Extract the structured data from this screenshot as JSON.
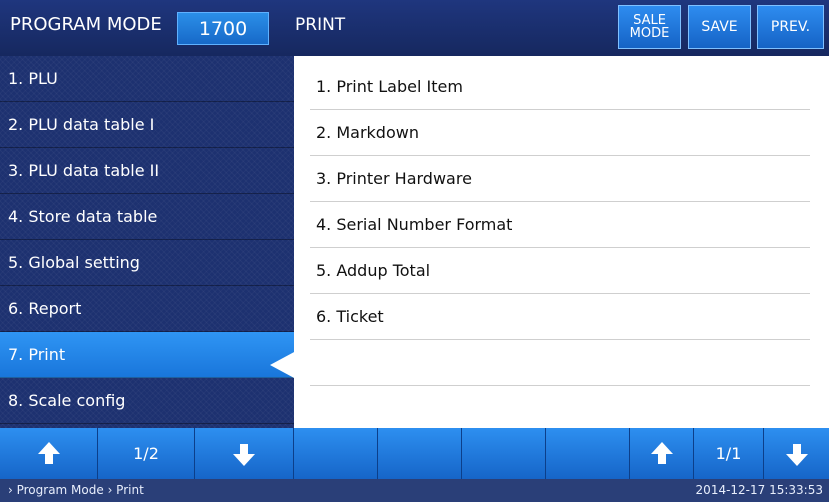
{
  "header": {
    "mode_label": "PROGRAM MODE",
    "mode_number": "1700",
    "screen_title": "PRINT",
    "buttons": {
      "sale_line1": "SALE",
      "sale_line2": "MODE",
      "save": "SAVE",
      "prev": "PREV."
    }
  },
  "left_menu": {
    "selected_index": 6,
    "items": [
      {
        "label": "1. PLU"
      },
      {
        "label": "2. PLU data table I"
      },
      {
        "label": "3. PLU data table II"
      },
      {
        "label": "4. Store data table"
      },
      {
        "label": "5. Global setting"
      },
      {
        "label": "6. Report"
      },
      {
        "label": "7. Print"
      },
      {
        "label": "8. Scale config"
      }
    ]
  },
  "right_menu": {
    "items": [
      {
        "label": "1. Print Label Item"
      },
      {
        "label": "2. Markdown"
      },
      {
        "label": "3. Printer Hardware"
      },
      {
        "label": "4. Serial Number Format"
      },
      {
        "label": "5. Addup Total"
      },
      {
        "label": "6. Ticket"
      },
      {
        "label": ""
      },
      {
        "label": ""
      }
    ]
  },
  "pager": {
    "left": "1/2",
    "right": "1/1"
  },
  "status": {
    "breadcrumb": "› Program Mode › Print",
    "datetime": "2014-12-17 15:33:53"
  }
}
